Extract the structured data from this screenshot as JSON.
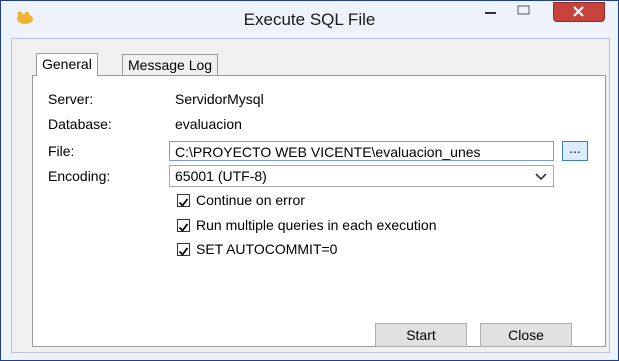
{
  "window": {
    "title": "Execute SQL File"
  },
  "tabs": [
    {
      "label": "General",
      "active": true
    },
    {
      "label": "Message Log",
      "active": false
    }
  ],
  "form": {
    "server_label": "Server:",
    "server_value": "ServidorMysql",
    "database_label": "Database:",
    "database_value": "evaluacion",
    "file_label": "File:",
    "file_value": "C:\\PROYECTO WEB VICENTE\\evaluacion_unes",
    "browse_label": "...",
    "encoding_label": "Encoding:",
    "encoding_value": "65001 (UTF-8)"
  },
  "options": [
    {
      "label": "Continue on error",
      "checked": true
    },
    {
      "label": "Run multiple queries in each execution",
      "checked": true
    },
    {
      "label": "SET AUTOCOMMIT=0",
      "checked": true
    }
  ],
  "buttons": {
    "start": "Start",
    "close": "Close"
  },
  "colors": {
    "close_button": "#c7423a",
    "app_icon": "#f2b134",
    "input_border": "#7a9cd3"
  }
}
